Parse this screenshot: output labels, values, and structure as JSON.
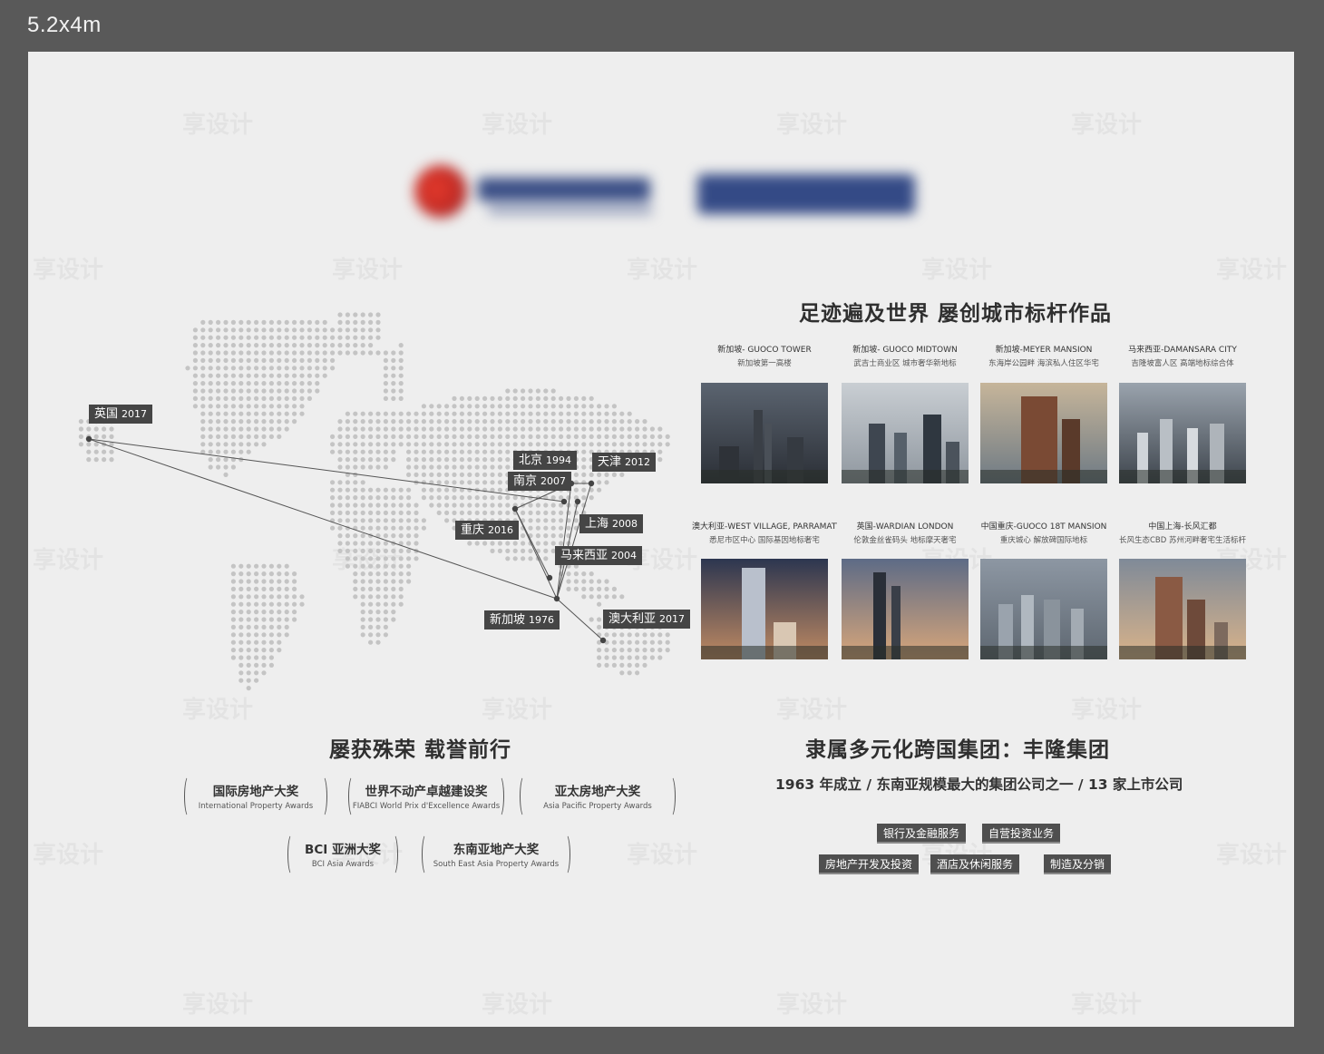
{
  "canvas_label": "5.2x4m",
  "logo": {
    "alt": "logo (blurred)"
  },
  "map": {
    "locations": [
      {
        "id": "uk",
        "name": "英国",
        "year": "2017"
      },
      {
        "id": "beijing",
        "name": "北京",
        "year": "1994"
      },
      {
        "id": "tianjin",
        "name": "天津",
        "year": "2012"
      },
      {
        "id": "nanjing",
        "name": "南京",
        "year": "2007"
      },
      {
        "id": "chongqing",
        "name": "重庆",
        "year": "2016"
      },
      {
        "id": "shanghai",
        "name": "上海",
        "year": "2008"
      },
      {
        "id": "malaysia",
        "name": "马来西亚",
        "year": "2004"
      },
      {
        "id": "singapore",
        "name": "新加坡",
        "year": "1976"
      },
      {
        "id": "australia",
        "name": "澳大利亚",
        "year": "2017"
      }
    ]
  },
  "projects_title": "足迹遍及世界  屡创城市标杆作品",
  "projects": [
    {
      "name": "新加坡- GUOCO TOWER",
      "desc": "新加坡第一高楼"
    },
    {
      "name": "新加坡- GUOCO MIDTOWN",
      "desc": "武吉士商业区 城市奢华新地标"
    },
    {
      "name": "新加坡-MEYER MANSION",
      "desc": "东海岸公园畔  海滨私人住区华宅"
    },
    {
      "name": "马来西亚-DAMANSARA CITY",
      "desc": "吉隆坡富人区  高端地标综合体"
    },
    {
      "name": "澳大利亚-WEST VILLAGE, PARRAMATTA",
      "desc": "悉尼市区中心  国际基因地标奢宅"
    },
    {
      "name": "英国-WARDIAN LONDON",
      "desc": "伦敦金丝雀码头  地标摩天奢宅"
    },
    {
      "name": "中国重庆-GUOCO 18T MANSION",
      "desc": "重庆城心  解放碑国际地标"
    },
    {
      "name": "中国上海-长风汇都",
      "desc": "长风生态CBD  苏州河畔奢宅生活标杆"
    }
  ],
  "awards_title": "屡获殊荣  载誉前行",
  "awards": [
    {
      "name": "国际房地产大奖",
      "en": "International Property Awards"
    },
    {
      "name": "世界不动产卓越建设奖",
      "en": "FIABCI World Prix d'Excellence Awards"
    },
    {
      "name": "亚太房地产大奖",
      "en": "Asia Pacific Property Awards"
    },
    {
      "name": "BCI 亚洲大奖",
      "en": "BCI Asia Awards"
    },
    {
      "name": "东南亚地产大奖",
      "en": "South East Asia Property Awards"
    }
  ],
  "group_title": "隶属多元化跨国集团：丰隆集团",
  "group_subtitle": "1963 年成立 / 东南亚规模最大的集团公司之一 / 13 家上市公司",
  "businesses": [
    "银行及金融服务",
    "自营投资业务",
    "房地产开发及投资",
    "酒店及休闲服务",
    "制造及分销"
  ],
  "watermark": "享设计",
  "colors": {
    "board": "#eeeeee",
    "frame": "#595959",
    "tag": "#454545",
    "title": "#2f2f2f",
    "dots": "#c4c4c4"
  }
}
